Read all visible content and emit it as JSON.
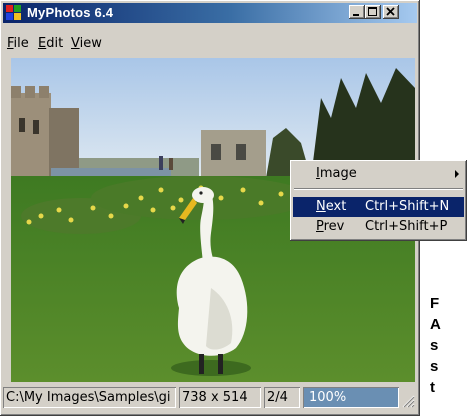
{
  "window": {
    "title": "MyPhotos 6.4",
    "icon": "app-photos-icon",
    "controls": [
      "minimize-icon",
      "maximize-icon",
      "close-icon"
    ]
  },
  "menubar": {
    "items": [
      {
        "label": "File",
        "mnemonic": "F",
        "rest": "ile"
      },
      {
        "label": "Edit",
        "mnemonic": "E",
        "rest": "dit"
      },
      {
        "label": "View",
        "mnemonic": "V",
        "rest": "iew"
      }
    ]
  },
  "photo": {
    "description_icon": "swan-photo"
  },
  "statusbar": {
    "path": "C:\\My Images\\Samples\\gi",
    "dimensions": "738 x 514",
    "position": "2/4",
    "progress_text": "100%",
    "progress_fraction": 1.0
  },
  "context_menu": {
    "items": [
      {
        "label": "Image",
        "mnemonic": "I",
        "rest": "mage",
        "shortcut": "",
        "submenu": true,
        "selected": false
      },
      {
        "label": "Next",
        "mnemonic": "N",
        "rest": "ext",
        "shortcut": "Ctrl+Shift+N",
        "submenu": false,
        "selected": true
      },
      {
        "label": "Prev",
        "mnemonic": "P",
        "rest": "rev",
        "shortcut": "Ctrl+Shift+P",
        "submenu": false,
        "selected": false
      }
    ]
  },
  "side_text": {
    "lines": [
      "F",
      "A",
      "s",
      "s",
      "t"
    ]
  },
  "colors": {
    "titlebar_start": "#0a246a",
    "titlebar_end": "#a6caf0",
    "face": "#d4d0c8",
    "highlight": "#0a246a",
    "progress": "#6a8fb3"
  }
}
